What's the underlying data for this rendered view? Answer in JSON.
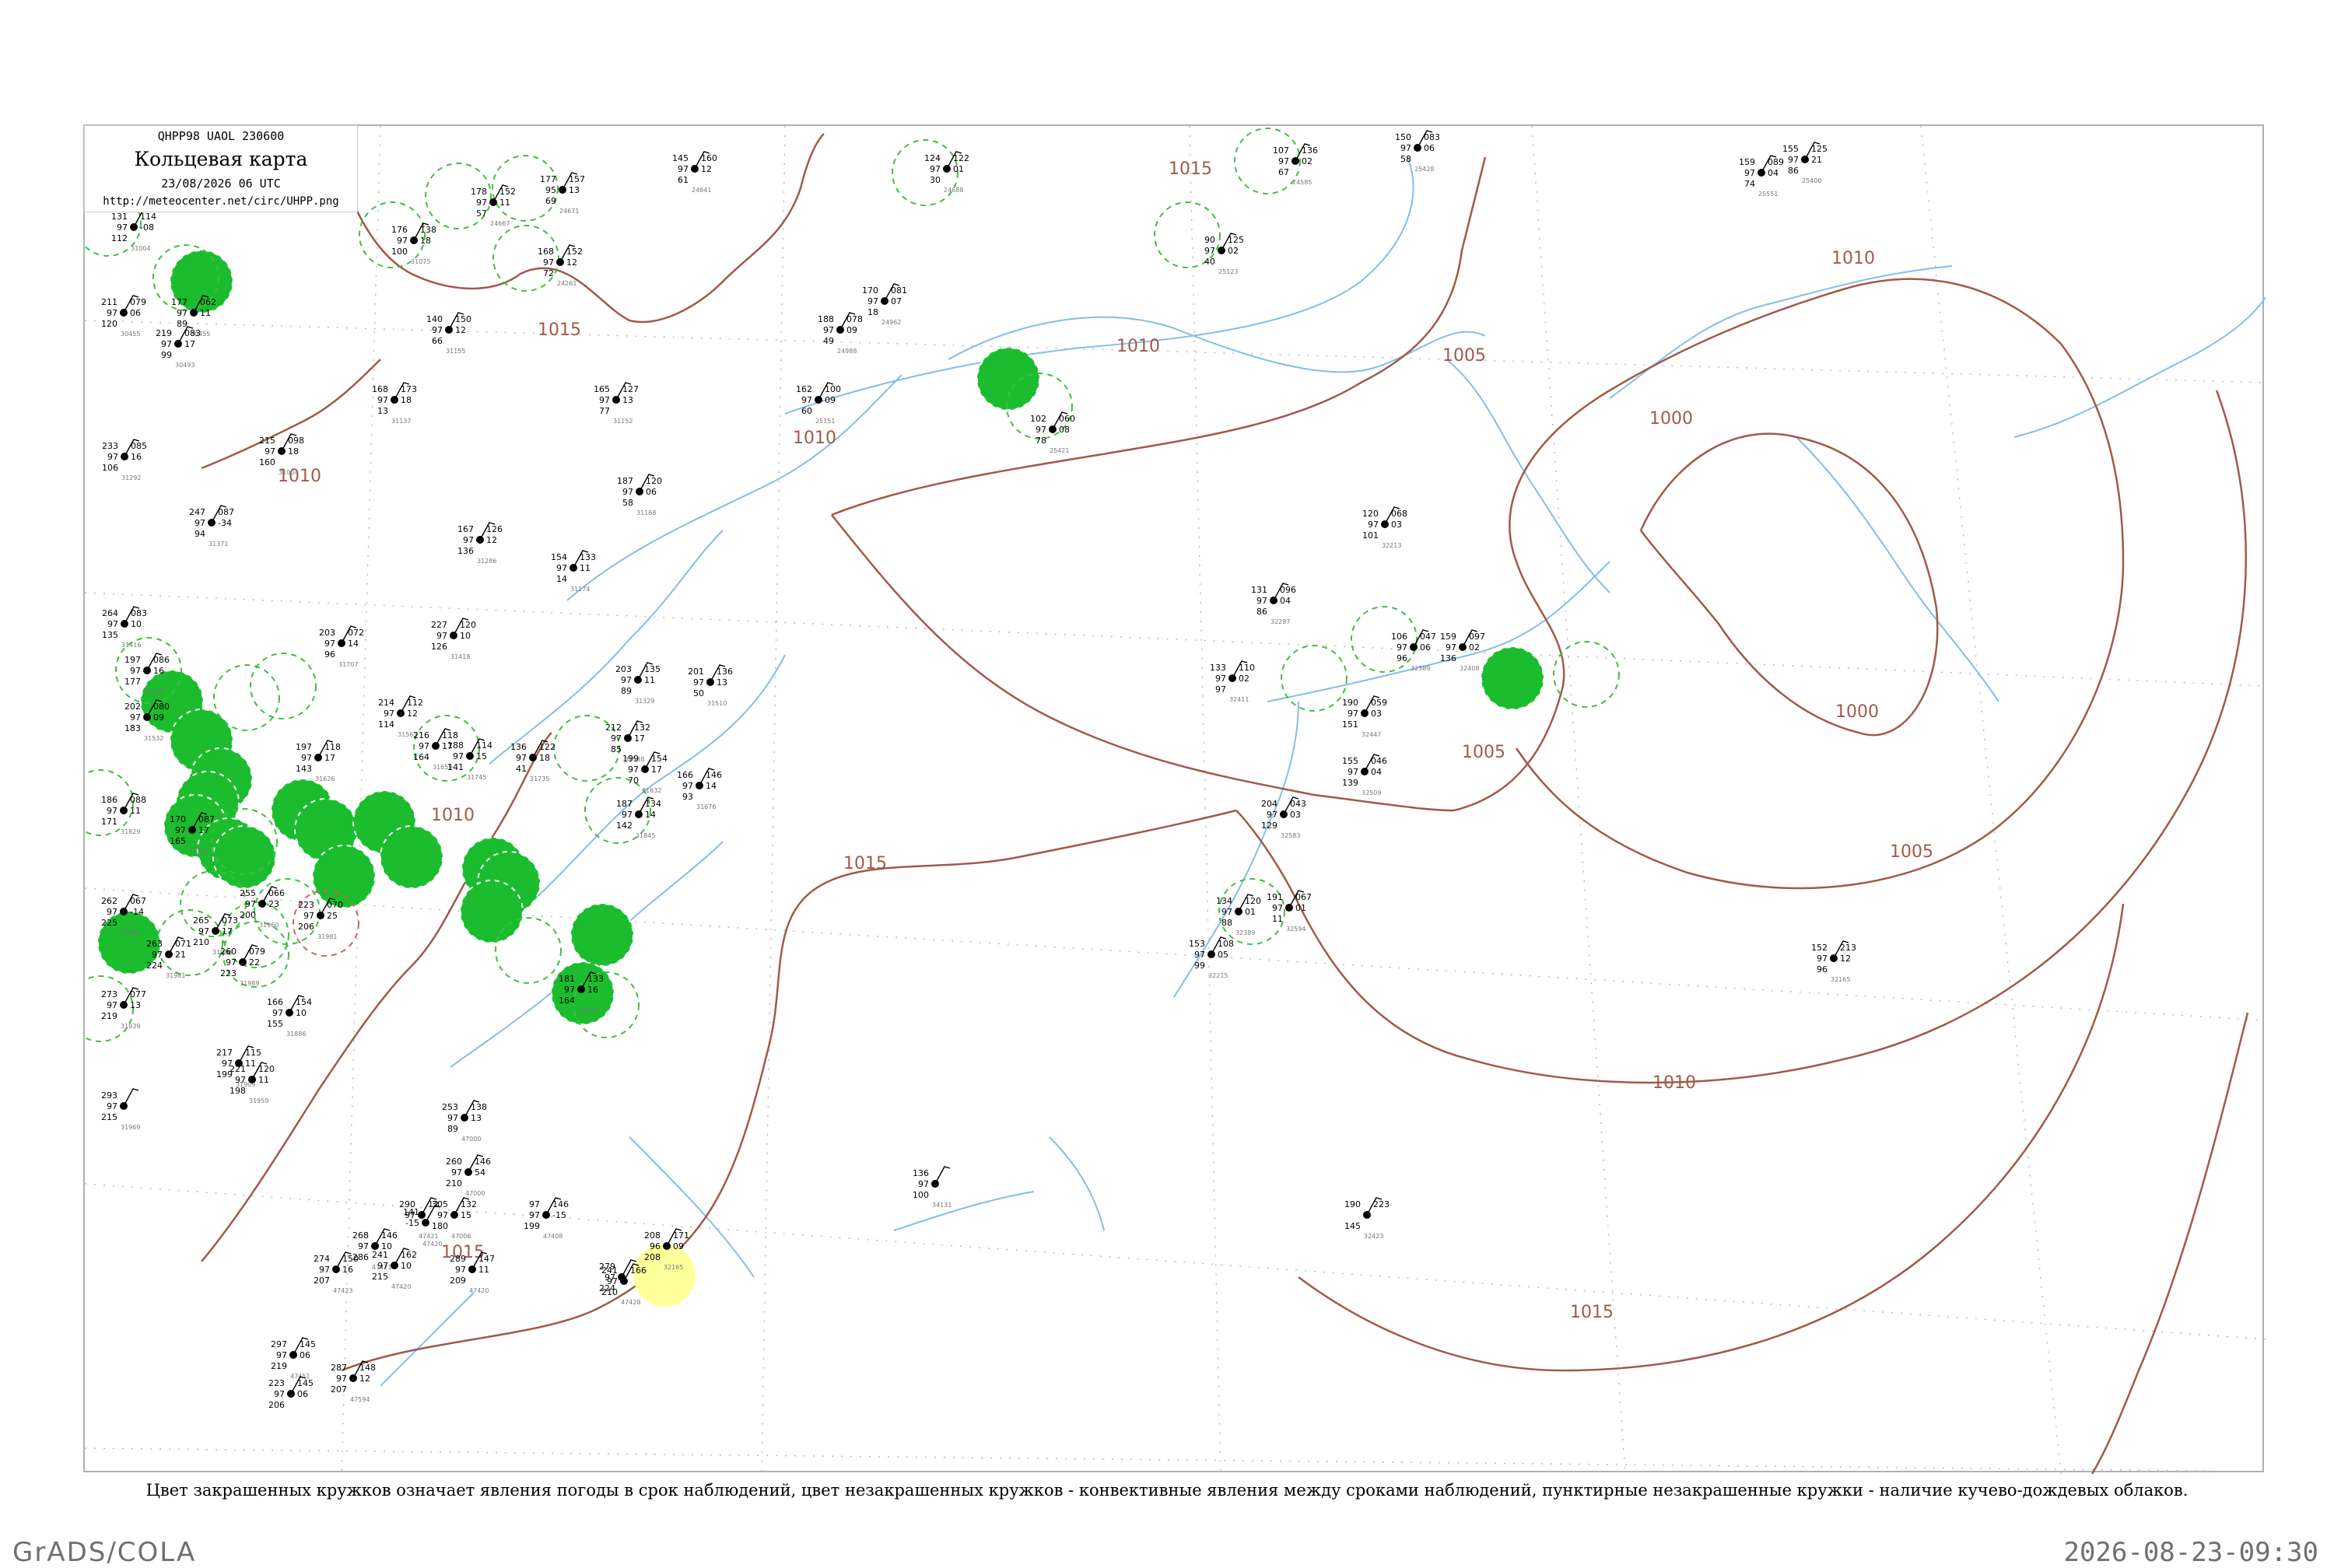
{
  "title_box": {
    "code": "QHPP98  UAOL  230600",
    "title": "Кольцевая карта",
    "date": "23/08/2026 06 UTC",
    "url": "http://meteocenter.net/circ/UHPP.png"
  },
  "caption": "Цвет закрашенных кружков означает явления погоды в срок наблюдений, цвет незакрашенных кружков - конвективные явления между сроками наблюдений, пунктирные незакрашенные кружки - наличие кучево-дождевых облаков.",
  "footer": {
    "left": "GrADS/COLA",
    "right": "2026-08-23-09:30"
  },
  "colors": {
    "isobar": "#a05a4a",
    "river": "#86bde6",
    "filled_circle": "#1bbd2e",
    "dashed_circle": "#3fbf3f",
    "yellow_circle": "#ffff9c"
  },
  "isobar_labels": [
    {
      "text": "1015"
    },
    {
      "text": "1015"
    },
    {
      "text": "1010"
    },
    {
      "text": "1010"
    },
    {
      "text": "1010"
    },
    {
      "text": "1005"
    },
    {
      "text": "1000"
    },
    {
      "text": "1010"
    },
    {
      "text": "1000"
    },
    {
      "text": "1005"
    },
    {
      "text": "1005"
    },
    {
      "text": "1015"
    },
    {
      "text": "1010"
    },
    {
      "text": "1010"
    },
    {
      "text": "1015"
    },
    {
      "text": "1015"
    }
  ],
  "stations": [
    {
      "t": "131",
      "v": "97",
      "p": "112",
      "dt": "114",
      "dp": "-08",
      "id": "31004"
    },
    {
      "t": "177",
      "v": "97",
      "p": "89",
      "dt": "062",
      "dp": "11",
      "id": "30455"
    },
    {
      "t": "178",
      "v": "97",
      "p": "57",
      "dt": "152",
      "dp": "11",
      "id": "24667"
    },
    {
      "t": "177",
      "v": "95",
      "p": "69",
      "dt": "157",
      "dp": "13",
      "id": "24671"
    },
    {
      "t": "168",
      "v": "97",
      "p": "72",
      "dt": "152",
      "dp": "12",
      "id": "24261"
    },
    {
      "t": "176",
      "v": "97",
      "p": "100",
      "dt": "138",
      "dp": "18",
      "id": "31075"
    },
    {
      "t": "145",
      "v": "97",
      "p": "61",
      "dt": "160",
      "dp": "12",
      "id": "24641"
    },
    {
      "t": "124",
      "v": "97",
      "p": "30",
      "dt": "122",
      "dp": "01",
      "id": "24688"
    },
    {
      "t": "107",
      "v": "97",
      "p": "67",
      "dt": "136",
      "dp": "02",
      "id": "24585"
    },
    {
      "t": "90",
      "v": "97",
      "p": "40",
      "dt": "125",
      "dp": "02",
      "id": "25123"
    },
    {
      "t": "150",
      "v": "97",
      "p": "58",
      "dt": "083",
      "dp": "06",
      "id": "25428"
    },
    {
      "t": "159",
      "v": "97",
      "p": "74",
      "dt": "089",
      "dp": "04",
      "id": "25551"
    },
    {
      "t": "155",
      "v": "97",
      "p": "86",
      "dt": "125",
      "dp": "21",
      "id": "25400"
    },
    {
      "t": "211",
      "v": "97",
      "p": "120",
      "dt": "079",
      "dp": "06",
      "id": "30455"
    },
    {
      "t": "219",
      "v": "97",
      "p": "99",
      "dt": "083",
      "dp": "17",
      "id": "30493"
    },
    {
      "t": "140",
      "v": "97",
      "p": "66",
      "dt": "150",
      "dp": "12",
      "id": "31155"
    },
    {
      "t": "170",
      "v": "97",
      "p": "18",
      "dt": "081",
      "dp": "07",
      "id": "24962"
    },
    {
      "t": "188",
      "v": "97",
      "p": "49",
      "dt": "078",
      "dp": "09",
      "id": "24988"
    },
    {
      "t": "162",
      "v": "97",
      "p": "60",
      "dt": "100",
      "dp": "09",
      "id": "25151"
    },
    {
      "t": "168",
      "v": "97",
      "p": "13",
      "dt": "173",
      "dp": "18",
      "id": "31137"
    },
    {
      "t": "165",
      "v": "97",
      "p": "77",
      "dt": "127",
      "dp": "13",
      "id": "31152"
    },
    {
      "t": "102",
      "v": "97",
      "p": "78",
      "dt": "060",
      "dp": "08",
      "id": "25421"
    },
    {
      "t": "233",
      "v": "97",
      "p": "106",
      "dt": "085",
      "dp": "16",
      "id": "31292"
    },
    {
      "t": "215",
      "v": "97",
      "p": "160",
      "dt": "098",
      "dp": "18",
      "id": "31004"
    },
    {
      "t": "187",
      "v": "97",
      "p": "58",
      "dt": "120",
      "dp": "06",
      "id": "31168"
    },
    {
      "t": "247",
      "v": "97",
      "p": "94",
      "dt": "087",
      "dp": "-34",
      "id": "31371"
    },
    {
      "t": "167",
      "v": "97",
      "p": "136",
      "dt": "126",
      "dp": "12",
      "id": "31286"
    },
    {
      "t": "154",
      "v": "97",
      "p": "14",
      "dt": "133",
      "dp": "11",
      "id": "31174"
    },
    {
      "t": "120",
      "v": "97",
      "p": "101",
      "dt": "068",
      "dp": "03",
      "id": "32213"
    },
    {
      "t": "131",
      "v": "97",
      "p": "86",
      "dt": "096",
      "dp": "04",
      "id": "32287"
    },
    {
      "t": "106",
      "v": "97",
      "p": "96",
      "dt": "047",
      "dp": "06",
      "id": "32389"
    },
    {
      "t": "159",
      "v": "97",
      "p": "136",
      "dt": "097",
      "dp": "02",
      "id": "32408"
    },
    {
      "t": "264",
      "v": "97",
      "p": "135",
      "dt": "083",
      "dp": "10",
      "id": "31416"
    },
    {
      "t": "197",
      "v": "97",
      "p": "177",
      "dt": "086",
      "dp": "16",
      "id": "31418"
    },
    {
      "t": "202",
      "v": "97",
      "p": "183",
      "dt": "080",
      "dp": "09",
      "id": "31532"
    },
    {
      "t": "203",
      "v": "97",
      "p": "96",
      "dt": "072",
      "dp": "14",
      "id": "31707"
    },
    {
      "t": "227",
      "v": "97",
      "p": "126",
      "dt": "120",
      "dp": "10",
      "id": "31418"
    },
    {
      "t": "203",
      "v": "97",
      "p": "89",
      "dt": "135",
      "dp": "11",
      "id": "31329"
    },
    {
      "t": "201",
      "v": "97",
      "p": "50",
      "dt": "136",
      "dp": "13",
      "id": "31510"
    },
    {
      "t": "214",
      "v": "97",
      "p": "114",
      "dt": "112",
      "dp": "12",
      "id": "31563"
    },
    {
      "t": "216",
      "v": "97",
      "p": "164",
      "dt": "118",
      "dp": "17",
      "id": "31659"
    },
    {
      "t": "212",
      "v": "97",
      "p": "85",
      "dt": "132",
      "dp": "17",
      "id": "31538"
    },
    {
      "t": "197",
      "v": "97",
      "p": "143",
      "dt": "118",
      "dp": "17",
      "id": "31626"
    },
    {
      "t": "188",
      "v": "97",
      "p": "141",
      "dt": "114",
      "dp": "15",
      "id": "31745"
    },
    {
      "t": "136",
      "v": "97",
      "p": "41",
      "dt": "122",
      "dp": "18",
      "id": "31735"
    },
    {
      "t": "199",
      "v": "97",
      "p": "70",
      "dt": "154",
      "dp": "17",
      "id": "31632"
    },
    {
      "t": "166",
      "v": "97",
      "p": "93",
      "dt": "146",
      "dp": "14",
      "id": "31676"
    },
    {
      "t": "190",
      "v": "97",
      "p": "151",
      "dt": "059",
      "dp": "03",
      "id": "32447"
    },
    {
      "t": "155",
      "v": "97",
      "p": "139",
      "dt": "046",
      "dp": "04",
      "id": "32509"
    },
    {
      "t": "133",
      "v": "97",
      "p": "97",
      "dt": "110",
      "dp": "02",
      "id": "32411"
    },
    {
      "t": "204",
      "v": "97",
      "p": "129",
      "dt": "043",
      "dp": "03",
      "id": "32583"
    },
    {
      "t": "186",
      "v": "97",
      "p": "171",
      "dt": "088",
      "dp": "11",
      "id": "31829"
    },
    {
      "t": "170",
      "v": "97",
      "p": "165",
      "dt": "087",
      "dp": "17",
      "id": "31860"
    },
    {
      "t": "187",
      "v": "97",
      "p": "142",
      "dt": "134",
      "dp": "14",
      "id": "31845"
    },
    {
      "t": "262",
      "v": "97",
      "p": "225",
      "dt": "067",
      "dp": "-14",
      "id": "31989"
    },
    {
      "t": "255",
      "v": "97",
      "p": "200",
      "dt": "066",
      "dp": "23",
      "id": "31960"
    },
    {
      "t": "223",
      "v": "97",
      "p": "206",
      "dt": "070",
      "dp": "25",
      "id": "31981"
    },
    {
      "t": "265",
      "v": "97",
      "p": "210",
      "dt": "073",
      "dp": "17",
      "id": "31986"
    },
    {
      "t": "263",
      "v": "97",
      "p": "224",
      "dt": "071",
      "dp": "21",
      "id": "31981"
    },
    {
      "t": "260",
      "v": "97",
      "p": "223",
      "dt": "079",
      "dp": "22",
      "id": "31989"
    },
    {
      "t": "273",
      "v": "97",
      "p": "219",
      "dt": "077",
      "dp": "13",
      "id": "31939"
    },
    {
      "t": "134",
      "v": "97",
      "p": "88",
      "dt": "120",
      "dp": "01",
      "id": "32389"
    },
    {
      "t": "191",
      "v": "97",
      "p": "11",
      "dt": "067",
      "dp": "01",
      "id": "32594"
    },
    {
      "t": "153",
      "v": "97",
      "p": "99",
      "dt": "108",
      "dp": "05",
      "id": "32215"
    },
    {
      "t": "181",
      "v": "97",
      "p": "164",
      "dt": "133",
      "dp": "16",
      "id": "31873"
    },
    {
      "t": "166",
      "v": "97",
      "p": "155",
      "dt": "154",
      "dp": "10",
      "id": "31886"
    },
    {
      "t": "217",
      "v": "97",
      "p": "199",
      "dt": "115",
      "dp": "11",
      "id": "31909"
    },
    {
      "t": "221",
      "v": "97",
      "p": "198",
      "dt": "120",
      "dp": "11",
      "id": "31959"
    },
    {
      "t": "293",
      "v": "97",
      "p": "215",
      "dt": "",
      "dp": "",
      "id": "31969"
    },
    {
      "t": "152",
      "v": "97",
      "p": "96",
      "dt": "213",
      "dp": "12",
      "id": "32165"
    },
    {
      "t": "253",
      "v": "97",
      "p": "89",
      "dt": "138",
      "dp": "13",
      "id": "47000"
    },
    {
      "t": "260",
      "v": "97",
      "p": "210",
      "dt": "146",
      "dp": "54",
      "id": "47000"
    },
    {
      "t": "305",
      "v": "97",
      "p": "180",
      "dt": "132",
      "dp": "15",
      "id": "47006"
    },
    {
      "t": "97",
      "v": "97",
      "p": "199",
      "dt": "146",
      "dp": "-15",
      "id": "47408"
    },
    {
      "t": "136",
      "v": "97",
      "p": "100",
      "dt": "",
      "dp": "",
      "id": "34131"
    },
    {
      "t": "190",
      "v": "",
      "p": "145",
      "dt": "223",
      "dp": "",
      "id": "32423"
    },
    {
      "t": "268",
      "v": "97",
      "p": "286",
      "dt": "146",
      "dp": "10",
      "id": "47421"
    },
    {
      "t": "290",
      "v": "97",
      "p": "",
      "dt": "12",
      "dp": "",
      "id": "47421"
    },
    {
      "t": "141",
      "v": "-15",
      "p": "",
      "dt": "",
      "dp": "",
      "id": "47420"
    },
    {
      "t": "274",
      "v": "97",
      "p": "207",
      "dt": "150",
      "dp": "16",
      "id": "47423"
    },
    {
      "t": "241",
      "v": "97",
      "p": "215",
      "dt": "162",
      "dp": "10",
      "id": "47420"
    },
    {
      "t": "289",
      "v": "97",
      "p": "209",
      "dt": "147",
      "dp": "11",
      "id": "47420"
    },
    {
      "t": "208",
      "v": "96",
      "p": "208",
      "dt": "171",
      "dp": "09",
      "id": "32165"
    },
    {
      "t": "241",
      "v": "97",
      "p": "210",
      "dt": "166",
      "dp": "",
      "id": "47428"
    },
    {
      "t": "279",
      "v": "97",
      "p": "224",
      "dt": "",
      "dp": "",
      "id": ""
    },
    {
      "t": "297",
      "v": "97",
      "p": "219",
      "dt": "145",
      "dp": "06",
      "id": "47451"
    },
    {
      "t": "223",
      "v": "97",
      "p": "206",
      "dt": "145",
      "dp": "06",
      "id": ""
    },
    {
      "t": "287",
      "v": "97",
      "p": "207",
      "dt": "148",
      "dp": "12",
      "id": "47594"
    }
  ]
}
